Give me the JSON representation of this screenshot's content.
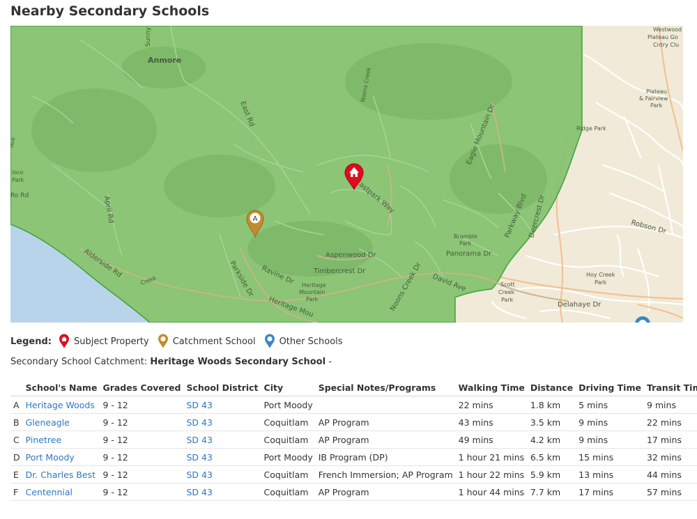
{
  "page": {
    "title": "Nearby Secondary Schools"
  },
  "map": {
    "labels": {
      "anmore": "Anmore",
      "east_rd": "East Rd",
      "sunny": "Sunny",
      "april_rd": "April Rd",
      "alderside_rd": "Alderside Rd",
      "parkside_dr": "Parkside Dr",
      "ravine_dr": "Ravine Dr",
      "heritage_mou": "Heritage Mou",
      "heritage_mountain_park_1": "Heritage",
      "heritage_mountain_park_2": "Mountain",
      "heritage_mountain_park_3": "Park",
      "timbercrest_dr": "Timbercrest Dr",
      "aspenwood_dr": "Aspenwood Dr",
      "eastpark_way": "Eastpark Way",
      "noons_creek": "Noons Creek",
      "eagle_mountain_dr": "Eagle Mountain Dr",
      "parkway_blvd": "Parkway Blvd",
      "bramble_park_1": "Bramble",
      "bramble_park_2": "Park",
      "panorama_dr": "Panorama Dr",
      "david_ave": "David Ave",
      "noons_creek_dr": "Noons Creek Dr",
      "scott_creek_park_1": "Scott",
      "scott_creek_park_2": "Creek",
      "scott_creek_park_3": "Park",
      "deercrest_dr": "Deercrest Dr",
      "robson_dr": "Robson Dr",
      "hoy_creek_park_1": "Hoy Creek",
      "hoy_creek_park_2": "Park",
      "delahaye_dr": "Delahaye Dr",
      "ridge_park": "Ridge Park",
      "plateau_park_1": "Plateau",
      "plateau_park_2": "& Fairview",
      "plateau_park_3": "Park",
      "westwood_1": "Westwood",
      "westwood_2": "Plateau Go",
      "westwood_3": "Cntry Clu",
      "loco_park_1": "loco",
      "loco_park_2": "Park",
      "ave": "Ave",
      "ro_rd": "Ro Rd",
      "creek": "Creek"
    },
    "markers": {
      "subject_icon": "home-icon",
      "catchment_letter": "A"
    },
    "colors": {
      "catchment_zone": "#7fbf6a",
      "water": "#b8d4ea",
      "land": "#f1ead8",
      "subject_pin": "#e00b1c",
      "catchment_pin": "#c68a2e",
      "other_pin": "#3a86c8"
    }
  },
  "legend": {
    "label": "Legend:",
    "items": [
      {
        "label": "Subject Property",
        "icon": "red-pin-icon"
      },
      {
        "label": "Catchment School",
        "icon": "orange-pin-icon"
      },
      {
        "label": "Other Schools",
        "icon": "blue-pin-icon"
      }
    ]
  },
  "catchment": {
    "prefix": "Secondary School Catchment:",
    "school": "Heritage Woods Secondary School",
    "suffix": "-"
  },
  "table": {
    "headers": [
      "School's Name",
      "Grades Covered",
      "School District",
      "City",
      "Special Notes/Programs",
      "Walking Time",
      "Distance",
      "Driving Time",
      "Transit Time"
    ],
    "rows": [
      {
        "letter": "A",
        "name": "Heritage Woods",
        "grades": "9 - 12",
        "district": "SD 43",
        "city": "Port Moody",
        "notes": "",
        "walking": "22 mins",
        "distance": "1.8 km",
        "driving": "5 mins",
        "transit": "9 mins"
      },
      {
        "letter": "B",
        "name": "Gleneagle",
        "grades": "9 - 12",
        "district": "SD 43",
        "city": "Coquitlam",
        "notes": "AP Program",
        "walking": "43 mins",
        "distance": "3.5 km",
        "driving": "9 mins",
        "transit": "22 mins"
      },
      {
        "letter": "C",
        "name": "Pinetree",
        "grades": "9 - 12",
        "district": "SD 43",
        "city": "Coquitlam",
        "notes": "AP Program",
        "walking": "49 mins",
        "distance": "4.2 km",
        "driving": "9 mins",
        "transit": "17 mins"
      },
      {
        "letter": "D",
        "name": "Port Moody",
        "grades": "9 - 12",
        "district": "SD 43",
        "city": "Port Moody",
        "notes": "IB Program (DP)",
        "walking": "1 hour 21 mins",
        "distance": "6.5 km",
        "driving": "15 mins",
        "transit": "32 mins"
      },
      {
        "letter": "E",
        "name": "Dr. Charles Best",
        "grades": "9 - 12",
        "district": "SD 43",
        "city": "Coquitlam",
        "notes": "French Immersion; AP Program",
        "walking": "1 hour 22 mins",
        "distance": "5.9 km",
        "driving": "13 mins",
        "transit": "44 mins"
      },
      {
        "letter": "F",
        "name": "Centennial",
        "grades": "9 - 12",
        "district": "SD 43",
        "city": "Coquitlam",
        "notes": "AP Program",
        "walking": "1 hour 44 mins",
        "distance": "7.7 km",
        "driving": "17 mins",
        "transit": "57 mins"
      }
    ]
  }
}
